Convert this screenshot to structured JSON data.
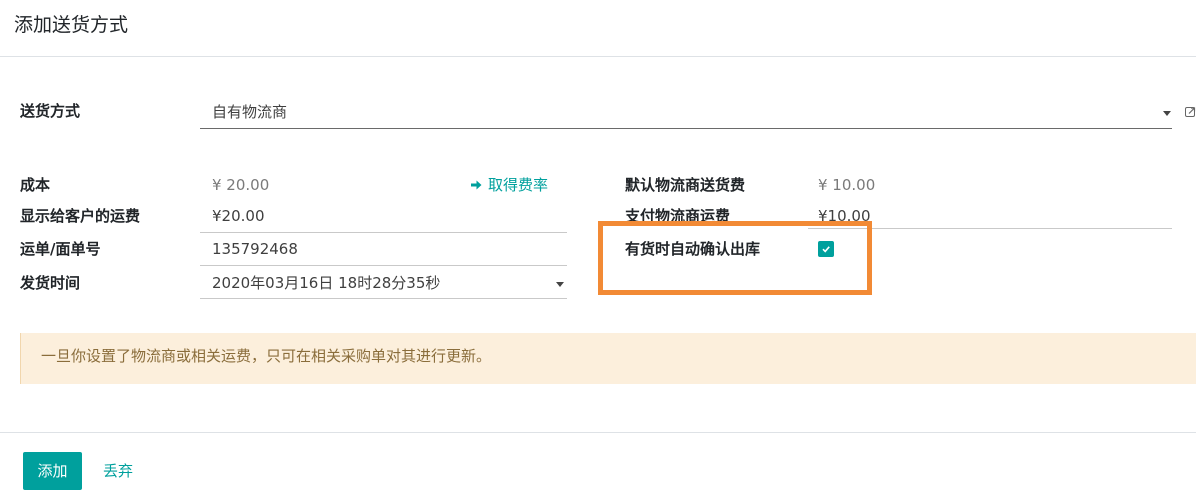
{
  "dialog": {
    "title": "添加送货方式"
  },
  "carrier": {
    "label": "送货方式",
    "value": "自有物流商"
  },
  "left_fields": [
    {
      "label": "成本",
      "value": "¥ 20.00"
    },
    {
      "label": "显示给客户的运费",
      "value": "¥20.00"
    },
    {
      "label": "运单/面单号",
      "value": "135792468"
    },
    {
      "label": "发货时间",
      "value": "2020年03月16日 18时28分35秒"
    }
  ],
  "get_rate": {
    "label": "取得费率"
  },
  "right_fields": [
    {
      "label": "默认物流商送货费",
      "value": "¥ 10.00"
    },
    {
      "label": "支付物流商运费",
      "value": "¥10.00"
    },
    {
      "label": "有货时自动确认出库",
      "checked": true
    }
  ],
  "alert": {
    "text": "一旦你设置了物流商或相关运费，只可在相关采购单对其进行更新。"
  },
  "footer": {
    "add_label": "添加",
    "discard_label": "丢弃"
  },
  "icons": {
    "get_rate": "arrow-right-icon",
    "dropdown": "caret-down-icon",
    "external": "external-link-icon",
    "checkbox": "checkmark-icon"
  },
  "colors": {
    "accent": "#00A09D",
    "highlight": "#F28A35",
    "alert_bg": "#FCEFDC",
    "alert_text": "#8A6D3B"
  }
}
